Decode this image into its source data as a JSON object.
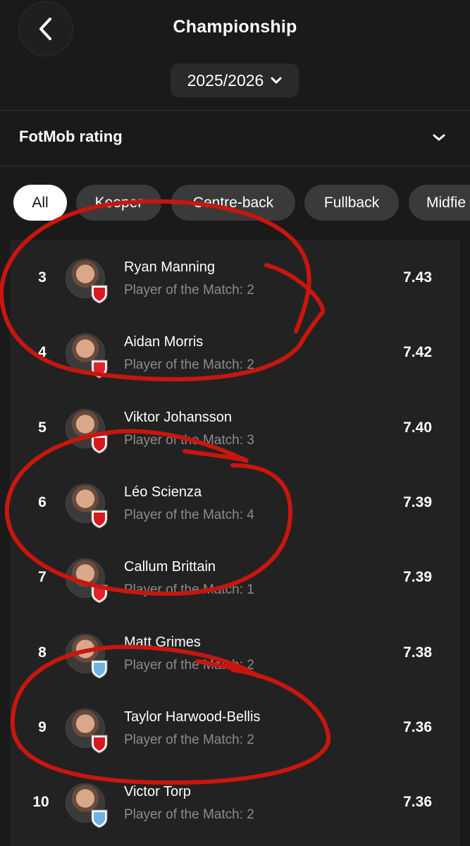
{
  "header": {
    "title": "Championship",
    "season": "2025/2026"
  },
  "stat_selector": {
    "label": "FotMob rating"
  },
  "filters": [
    {
      "label": "All",
      "active": true
    },
    {
      "label": "Keeper",
      "active": false
    },
    {
      "label": "Centre-back",
      "active": false
    },
    {
      "label": "Fullback",
      "active": false
    },
    {
      "label": "Midfie",
      "active": false
    }
  ],
  "players": [
    {
      "rank": "3",
      "name": "Ryan Manning",
      "potm": "Player of the Match: 2",
      "rating": "7.43",
      "club_color": "#d71920"
    },
    {
      "rank": "4",
      "name": "Aidan Morris",
      "potm": "Player of the Match: 2",
      "rating": "7.42",
      "club_color": "#e0242b"
    },
    {
      "rank": "5",
      "name": "Viktor Johansson",
      "potm": "Player of the Match: 3",
      "rating": "7.40",
      "club_color": "#d71920"
    },
    {
      "rank": "6",
      "name": "Léo Scienza",
      "potm": "Player of the Match: 4",
      "rating": "7.39",
      "club_color": "#d71920"
    },
    {
      "rank": "7",
      "name": "Callum Brittain",
      "potm": "Player of the Match: 1",
      "rating": "7.39",
      "club_color": "#e0242b"
    },
    {
      "rank": "8",
      "name": "Matt Grimes",
      "potm": "Player of the Match: 2",
      "rating": "7.38",
      "club_color": "#6cb4e4"
    },
    {
      "rank": "9",
      "name": "Taylor Harwood-Bellis",
      "potm": "Player of the Match: 2",
      "rating": "7.36",
      "club_color": "#d71920"
    },
    {
      "rank": "10",
      "name": "Victor Torp",
      "potm": "Player of the Match: 2",
      "rating": "7.36",
      "club_color": "#6cb4e4"
    }
  ],
  "colors": {
    "background": "#1a1a1a",
    "list_background": "#222222",
    "chip": "#3a3a3a",
    "chip_active": "#ffffff",
    "annotation": "#c8160e"
  }
}
